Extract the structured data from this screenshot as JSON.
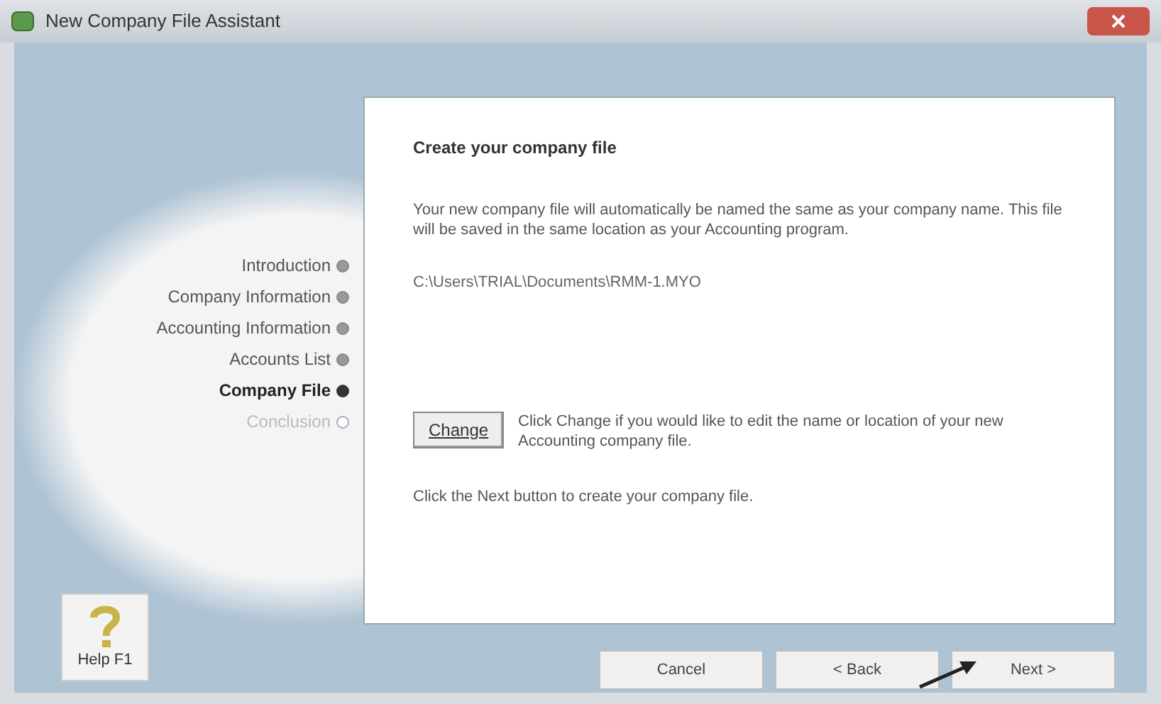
{
  "window": {
    "title": "New Company File Assistant"
  },
  "steps": [
    {
      "label": "Introduction",
      "selected": false,
      "disabled": false
    },
    {
      "label": "Company Information",
      "selected": false,
      "disabled": false
    },
    {
      "label": "Accounting Information",
      "selected": false,
      "disabled": false
    },
    {
      "label": "Accounts List",
      "selected": false,
      "disabled": false
    },
    {
      "label": "Company File",
      "selected": true,
      "disabled": false
    },
    {
      "label": "Conclusion",
      "selected": false,
      "disabled": true
    }
  ],
  "panel": {
    "heading": "Create your company file",
    "description": "Your new company file will automatically be named the same as your company name.  This file will be saved in the same location as your Accounting program.",
    "file_path": "C:\\Users\\TRIAL\\Documents\\RMM-1.MYO",
    "change_button": "Change",
    "change_hint": "Click Change if you would like to edit the name or location of your new Accounting company file.",
    "next_hint": "Click the Next button to create your company file."
  },
  "help_button": "Help F1",
  "buttons": [
    {
      "label": "Cancel"
    },
    {
      "label": "< Back"
    },
    {
      "label": "Next >"
    }
  ]
}
